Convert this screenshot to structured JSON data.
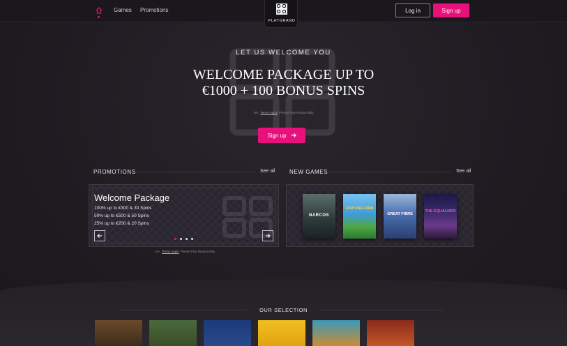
{
  "header": {
    "nav": {
      "games": "Games",
      "promotions": "Promotions"
    },
    "logo_text": "PLAYGRAND",
    "login_label": "Log in",
    "signup_label": "Sign up"
  },
  "hero": {
    "kicker": "LET US WELCOME YOU",
    "title_line1": "WELCOME PACKAGE UP TO",
    "title_line2": "€1000 + 100 BONUS SPINS",
    "terms_prefix": "18+.",
    "terms_link": "Terms Apply",
    "terms_suffix": "Please Play Responsibly",
    "cta_label": "Sign up"
  },
  "promotions": {
    "heading": "PROMOTIONS",
    "see_all": "See all",
    "card": {
      "title": "Welcome Package",
      "lines": [
        "100% up to €300 & 30 Spins",
        "50% up to €500 & 50 Spins",
        "25% up to €200 & 20 Spins"
      ]
    },
    "terms_prefix": "18+.",
    "terms_link": "Terms Apply",
    "terms_suffix": "Please Play Responsibly"
  },
  "new_games": {
    "heading": "NEW GAMES",
    "see_all": "See all",
    "tiles": [
      {
        "label": "NARCOS",
        "color": "#3a4a4a"
      },
      {
        "label": "FORTUNE FARM",
        "color": "#3f9bd8"
      },
      {
        "label": "GREAT FIBRE",
        "color": "#4a6fb0"
      },
      {
        "label": "THE EQUALIZER",
        "color": "#3a2a6a"
      }
    ]
  },
  "selection": {
    "heading": "OUR SELECTION"
  },
  "colors": {
    "accent": "#e8117c",
    "background": "#1e1c21"
  }
}
